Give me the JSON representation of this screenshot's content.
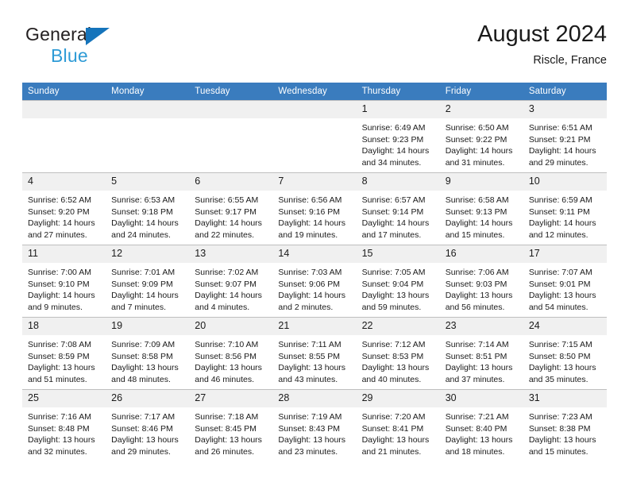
{
  "brand": {
    "name_part1": "General",
    "name_part2": "Blue",
    "logo_icon": "triangle-logo-icon"
  },
  "header": {
    "title": "August 2024",
    "subtitle": "Riscle, France"
  },
  "calendar": {
    "weekday_headers": [
      "Sunday",
      "Monday",
      "Tuesday",
      "Wednesday",
      "Thursday",
      "Friday",
      "Saturday"
    ],
    "colors": {
      "header_background": "#3a7cbe",
      "header_text": "#ffffff",
      "daynum_background": "#f0f0f0",
      "grid_line": "#bfbfbf",
      "brand_dark": "#231f20",
      "brand_blue": "#2e9bd6",
      "logo_blue": "#1574bb"
    },
    "weeks": [
      [
        {
          "day": "",
          "lines": []
        },
        {
          "day": "",
          "lines": []
        },
        {
          "day": "",
          "lines": []
        },
        {
          "day": "",
          "lines": []
        },
        {
          "day": "1",
          "lines": [
            "Sunrise: 6:49 AM",
            "Sunset: 9:23 PM",
            "Daylight: 14 hours",
            "and 34 minutes."
          ]
        },
        {
          "day": "2",
          "lines": [
            "Sunrise: 6:50 AM",
            "Sunset: 9:22 PM",
            "Daylight: 14 hours",
            "and 31 minutes."
          ]
        },
        {
          "day": "3",
          "lines": [
            "Sunrise: 6:51 AM",
            "Sunset: 9:21 PM",
            "Daylight: 14 hours",
            "and 29 minutes."
          ]
        }
      ],
      [
        {
          "day": "4",
          "lines": [
            "Sunrise: 6:52 AM",
            "Sunset: 9:20 PM",
            "Daylight: 14 hours",
            "and 27 minutes."
          ]
        },
        {
          "day": "5",
          "lines": [
            "Sunrise: 6:53 AM",
            "Sunset: 9:18 PM",
            "Daylight: 14 hours",
            "and 24 minutes."
          ]
        },
        {
          "day": "6",
          "lines": [
            "Sunrise: 6:55 AM",
            "Sunset: 9:17 PM",
            "Daylight: 14 hours",
            "and 22 minutes."
          ]
        },
        {
          "day": "7",
          "lines": [
            "Sunrise: 6:56 AM",
            "Sunset: 9:16 PM",
            "Daylight: 14 hours",
            "and 19 minutes."
          ]
        },
        {
          "day": "8",
          "lines": [
            "Sunrise: 6:57 AM",
            "Sunset: 9:14 PM",
            "Daylight: 14 hours",
            "and 17 minutes."
          ]
        },
        {
          "day": "9",
          "lines": [
            "Sunrise: 6:58 AM",
            "Sunset: 9:13 PM",
            "Daylight: 14 hours",
            "and 15 minutes."
          ]
        },
        {
          "day": "10",
          "lines": [
            "Sunrise: 6:59 AM",
            "Sunset: 9:11 PM",
            "Daylight: 14 hours",
            "and 12 minutes."
          ]
        }
      ],
      [
        {
          "day": "11",
          "lines": [
            "Sunrise: 7:00 AM",
            "Sunset: 9:10 PM",
            "Daylight: 14 hours",
            "and 9 minutes."
          ]
        },
        {
          "day": "12",
          "lines": [
            "Sunrise: 7:01 AM",
            "Sunset: 9:09 PM",
            "Daylight: 14 hours",
            "and 7 minutes."
          ]
        },
        {
          "day": "13",
          "lines": [
            "Sunrise: 7:02 AM",
            "Sunset: 9:07 PM",
            "Daylight: 14 hours",
            "and 4 minutes."
          ]
        },
        {
          "day": "14",
          "lines": [
            "Sunrise: 7:03 AM",
            "Sunset: 9:06 PM",
            "Daylight: 14 hours",
            "and 2 minutes."
          ]
        },
        {
          "day": "15",
          "lines": [
            "Sunrise: 7:05 AM",
            "Sunset: 9:04 PM",
            "Daylight: 13 hours",
            "and 59 minutes."
          ]
        },
        {
          "day": "16",
          "lines": [
            "Sunrise: 7:06 AM",
            "Sunset: 9:03 PM",
            "Daylight: 13 hours",
            "and 56 minutes."
          ]
        },
        {
          "day": "17",
          "lines": [
            "Sunrise: 7:07 AM",
            "Sunset: 9:01 PM",
            "Daylight: 13 hours",
            "and 54 minutes."
          ]
        }
      ],
      [
        {
          "day": "18",
          "lines": [
            "Sunrise: 7:08 AM",
            "Sunset: 8:59 PM",
            "Daylight: 13 hours",
            "and 51 minutes."
          ]
        },
        {
          "day": "19",
          "lines": [
            "Sunrise: 7:09 AM",
            "Sunset: 8:58 PM",
            "Daylight: 13 hours",
            "and 48 minutes."
          ]
        },
        {
          "day": "20",
          "lines": [
            "Sunrise: 7:10 AM",
            "Sunset: 8:56 PM",
            "Daylight: 13 hours",
            "and 46 minutes."
          ]
        },
        {
          "day": "21",
          "lines": [
            "Sunrise: 7:11 AM",
            "Sunset: 8:55 PM",
            "Daylight: 13 hours",
            "and 43 minutes."
          ]
        },
        {
          "day": "22",
          "lines": [
            "Sunrise: 7:12 AM",
            "Sunset: 8:53 PM",
            "Daylight: 13 hours",
            "and 40 minutes."
          ]
        },
        {
          "day": "23",
          "lines": [
            "Sunrise: 7:14 AM",
            "Sunset: 8:51 PM",
            "Daylight: 13 hours",
            "and 37 minutes."
          ]
        },
        {
          "day": "24",
          "lines": [
            "Sunrise: 7:15 AM",
            "Sunset: 8:50 PM",
            "Daylight: 13 hours",
            "and 35 minutes."
          ]
        }
      ],
      [
        {
          "day": "25",
          "lines": [
            "Sunrise: 7:16 AM",
            "Sunset: 8:48 PM",
            "Daylight: 13 hours",
            "and 32 minutes."
          ]
        },
        {
          "day": "26",
          "lines": [
            "Sunrise: 7:17 AM",
            "Sunset: 8:46 PM",
            "Daylight: 13 hours",
            "and 29 minutes."
          ]
        },
        {
          "day": "27",
          "lines": [
            "Sunrise: 7:18 AM",
            "Sunset: 8:45 PM",
            "Daylight: 13 hours",
            "and 26 minutes."
          ]
        },
        {
          "day": "28",
          "lines": [
            "Sunrise: 7:19 AM",
            "Sunset: 8:43 PM",
            "Daylight: 13 hours",
            "and 23 minutes."
          ]
        },
        {
          "day": "29",
          "lines": [
            "Sunrise: 7:20 AM",
            "Sunset: 8:41 PM",
            "Daylight: 13 hours",
            "and 21 minutes."
          ]
        },
        {
          "day": "30",
          "lines": [
            "Sunrise: 7:21 AM",
            "Sunset: 8:40 PM",
            "Daylight: 13 hours",
            "and 18 minutes."
          ]
        },
        {
          "day": "31",
          "lines": [
            "Sunrise: 7:23 AM",
            "Sunset: 8:38 PM",
            "Daylight: 13 hours",
            "and 15 minutes."
          ]
        }
      ]
    ]
  }
}
